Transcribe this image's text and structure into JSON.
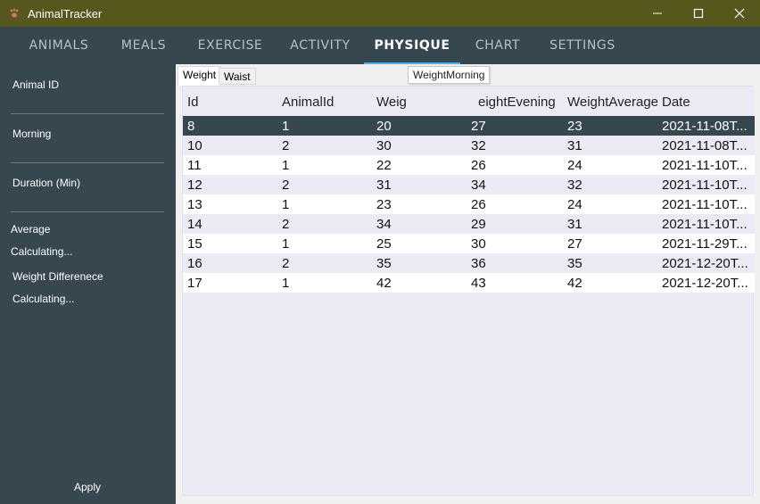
{
  "window": {
    "title": "AnimalTracker",
    "icon": "paw-icon"
  },
  "tabs": [
    {
      "label": "ANIMALS"
    },
    {
      "label": "MEALS"
    },
    {
      "label": "EXERCISE"
    },
    {
      "label": "ACTIVITY"
    },
    {
      "label": "PHYSIQUE"
    },
    {
      "label": "CHART"
    },
    {
      "label": "SETTINGS"
    }
  ],
  "active_tab": "PHYSIQUE",
  "sidebar": {
    "animal_id_label": "Animal ID",
    "morning_label": "Morning",
    "duration_label": "Duration (Min)",
    "average_label": "Average",
    "average_value": "Calculating...",
    "weight_diff_label": "Weight Differenece",
    "weight_diff_value": "Calculating...",
    "apply_label": "Apply"
  },
  "subtabs": [
    {
      "label": "Weight"
    },
    {
      "label": "Waist"
    }
  ],
  "grid": {
    "columns": [
      "Id",
      "AnimalId",
      "WeightMorning",
      "WeightEvening",
      "WeightAverage",
      "Date"
    ],
    "header_display": [
      "Id",
      "AnimalId",
      "Weig",
      "eightEvening",
      "WeightAverage",
      "Date"
    ],
    "tooltip": "WeightMorning",
    "rows": [
      [
        "8",
        "1",
        "20",
        "27",
        "23",
        "2021-11-08T..."
      ],
      [
        "10",
        "2",
        "30",
        "32",
        "31",
        "2021-11-08T..."
      ],
      [
        "11",
        "1",
        "22",
        "26",
        "24",
        "2021-11-10T..."
      ],
      [
        "12",
        "2",
        "31",
        "34",
        "32",
        "2021-11-10T..."
      ],
      [
        "13",
        "1",
        "23",
        "26",
        "24",
        "2021-11-10T..."
      ],
      [
        "14",
        "2",
        "34",
        "29",
        "31",
        "2021-11-10T..."
      ],
      [
        "15",
        "1",
        "25",
        "30",
        "27",
        "2021-11-29T..."
      ],
      [
        "16",
        "2",
        "35",
        "36",
        "35",
        "2021-12-20T..."
      ],
      [
        "17",
        "1",
        "42",
        "43",
        "42",
        "2021-12-20T..."
      ]
    ],
    "selected_row_index": 0
  },
  "colors": {
    "titlebar": "#55571C",
    "sidebar": "#37474F",
    "accent": "#4FB0E8",
    "selected_row": "#37474F"
  }
}
